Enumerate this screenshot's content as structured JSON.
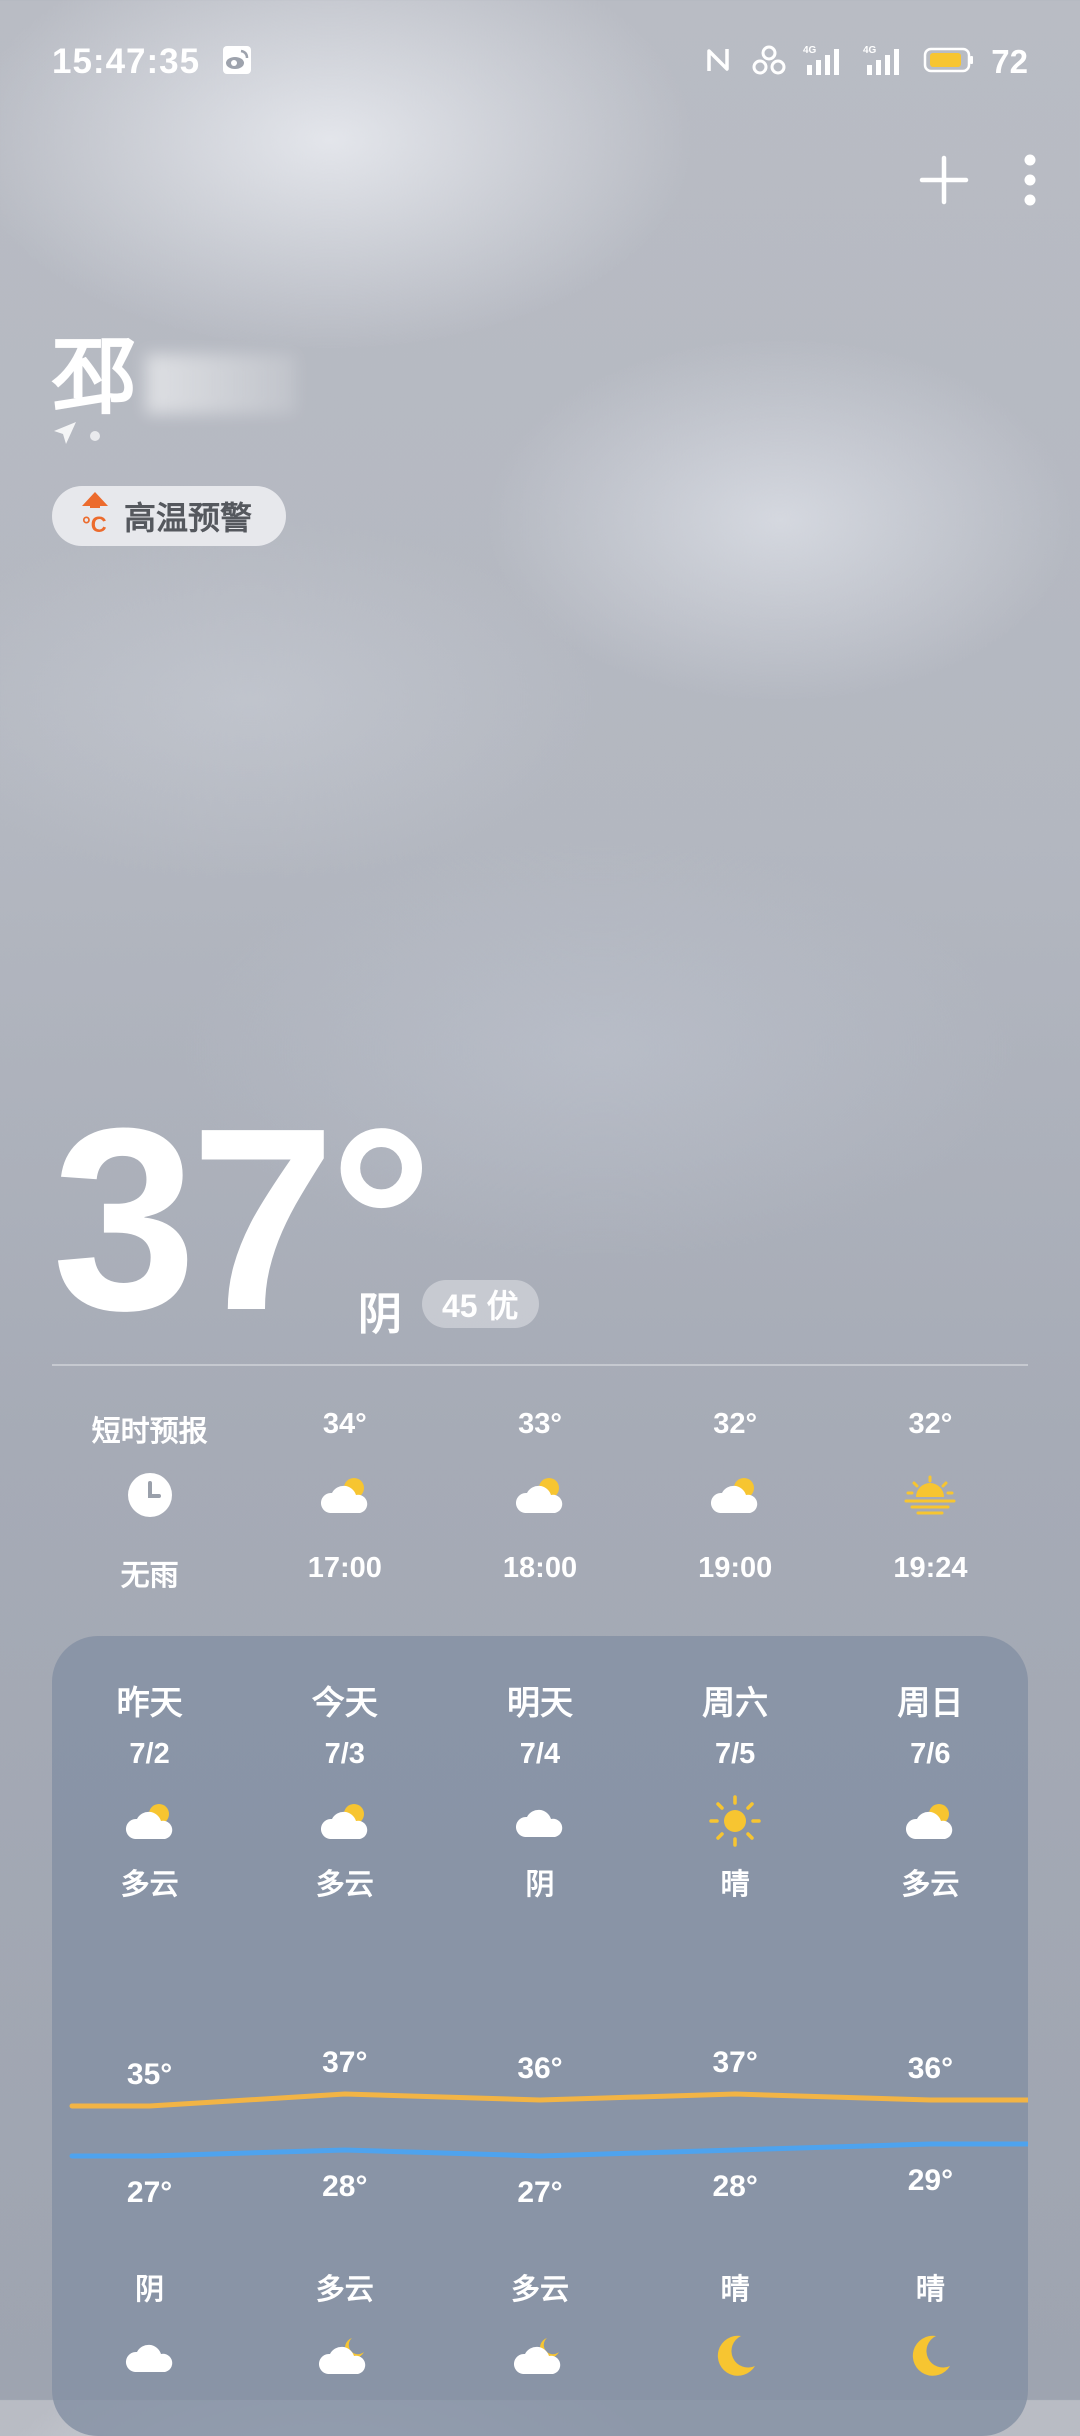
{
  "status_bar": {
    "time": "15:47:35",
    "battery": "72"
  },
  "location": {
    "city_visible": "邳"
  },
  "warning": {
    "label": "高温预警"
  },
  "current": {
    "temp": "37°",
    "condition": "阴",
    "aqi": "45 优"
  },
  "hourly": [
    {
      "top": "短时预报",
      "icon": "clock-icon",
      "bottom": "无雨"
    },
    {
      "top": "34°",
      "icon": "partly-cloudy-icon",
      "bottom": "17:00"
    },
    {
      "top": "33°",
      "icon": "partly-cloudy-icon",
      "bottom": "18:00"
    },
    {
      "top": "32°",
      "icon": "partly-cloudy-icon",
      "bottom": "19:00"
    },
    {
      "top": "32°",
      "icon": "sunset-icon",
      "bottom": "19:24"
    }
  ],
  "daily": [
    {
      "day": "昨天",
      "date": "7/2",
      "day_condition": "多云",
      "day_icon": "partly-cloudy-icon",
      "high": "35°",
      "low": "27°",
      "night_condition": "阴",
      "night_icon": "cloud-icon"
    },
    {
      "day": "今天",
      "date": "7/3",
      "day_condition": "多云",
      "day_icon": "partly-cloudy-icon",
      "high": "37°",
      "low": "28°",
      "night_condition": "多云",
      "night_icon": "cloudy-night-icon"
    },
    {
      "day": "明天",
      "date": "7/4",
      "day_condition": "阴",
      "day_icon": "cloud-icon",
      "high": "36°",
      "low": "27°",
      "night_condition": "多云",
      "night_icon": "cloudy-night-icon"
    },
    {
      "day": "周六",
      "date": "7/5",
      "day_condition": "晴",
      "day_icon": "sun-icon",
      "high": "37°",
      "low": "28°",
      "night_condition": "晴",
      "night_icon": "moon-icon"
    },
    {
      "day": "周日",
      "date": "7/6",
      "day_condition": "多云",
      "day_icon": "partly-cloudy-icon",
      "high": "36°",
      "low": "29°",
      "night_condition": "晴",
      "night_icon": "moon-icon"
    }
  ],
  "trend": {
    "highs": [
      35,
      37,
      36,
      37,
      36
    ],
    "lows": [
      27,
      28,
      27,
      28,
      29
    ]
  },
  "colors": {
    "high_line": "#f2b445",
    "low_line": "#4ea3ee",
    "sun": "#f7c531",
    "warning_icon": "#ec6b2d"
  }
}
